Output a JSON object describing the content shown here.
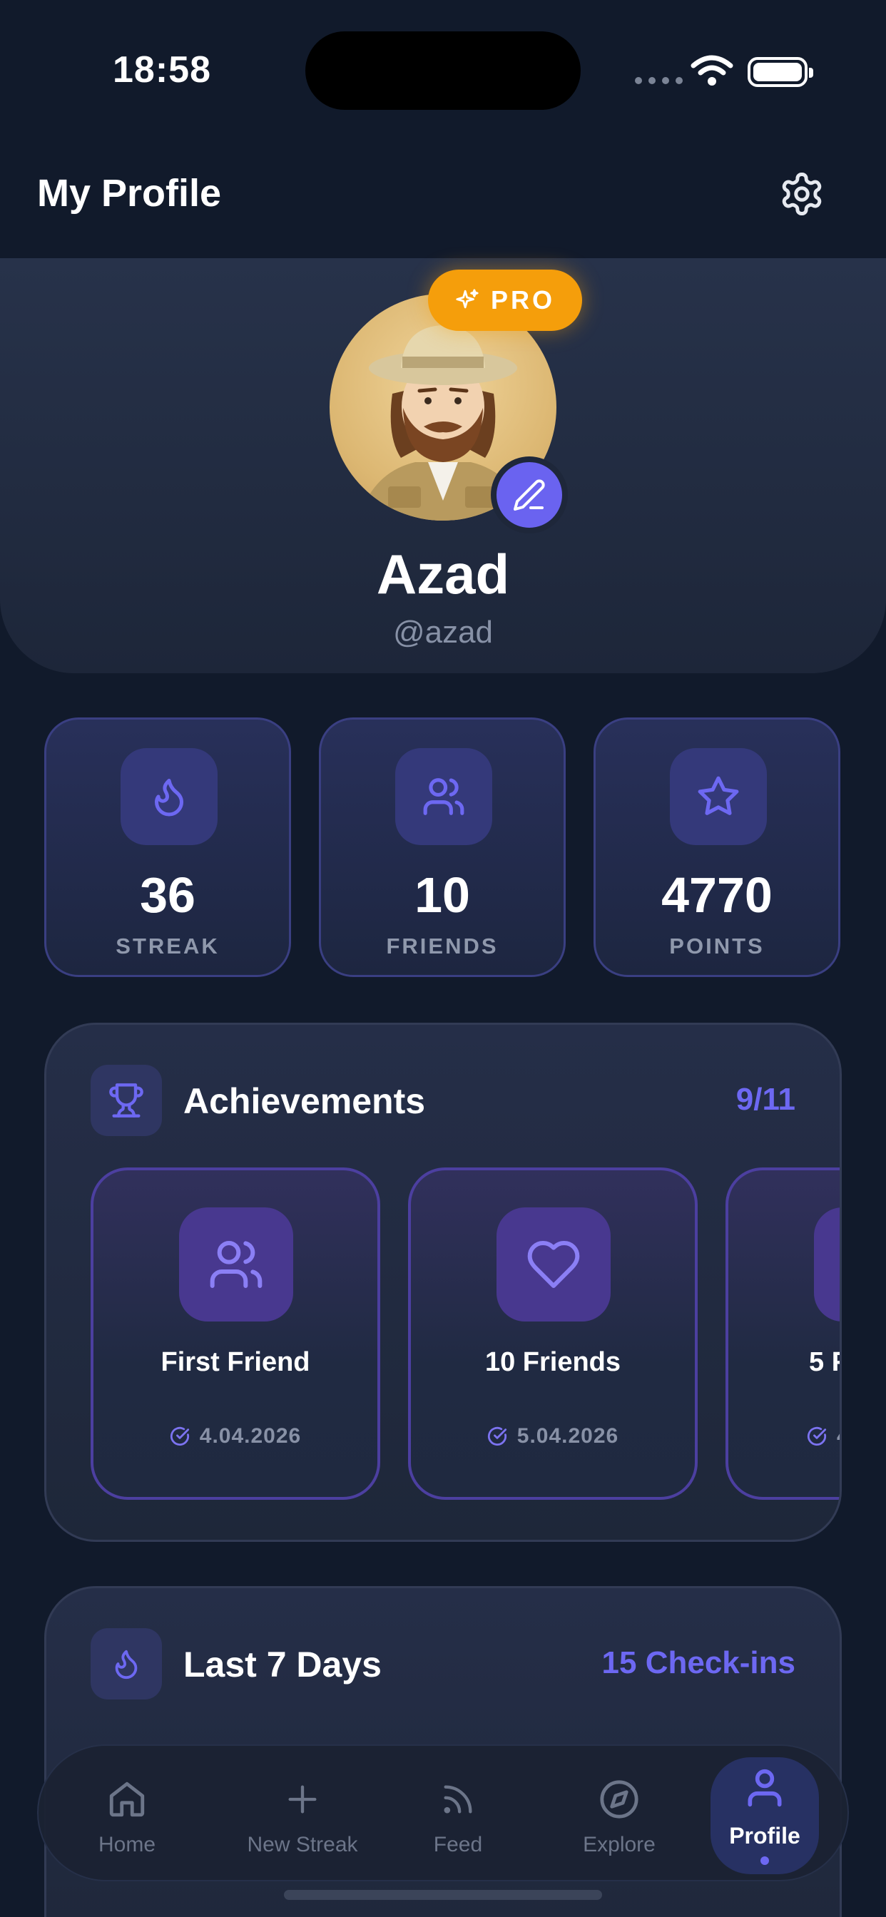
{
  "status_bar": {
    "time": "18:58"
  },
  "header": {
    "title": "My Profile",
    "settings_icon": "gear-icon"
  },
  "profile": {
    "badge": "PRO",
    "name": "Azad",
    "handle": "@azad",
    "accent_color": "#6a63f0",
    "badge_color": "#f59e0b"
  },
  "stats": [
    {
      "icon": "flame-icon",
      "value": "36",
      "label": "STREAK"
    },
    {
      "icon": "friends-icon",
      "value": "10",
      "label": "FRIENDS"
    },
    {
      "icon": "star-icon",
      "value": "4770",
      "label": "POINTS"
    }
  ],
  "achievements": {
    "title": "Achievements",
    "count": "9/11",
    "items": [
      {
        "icon": "friends-icon",
        "title": "First Friend",
        "date": "4.04.2026"
      },
      {
        "icon": "heart-icon",
        "title": "10 Friends",
        "date": "5.04.2026"
      },
      {
        "icon": "friends-icon",
        "title": "5 F",
        "date": "4"
      }
    ]
  },
  "last_7_days": {
    "title": "Last 7 Days",
    "count": "15 Check-ins"
  },
  "tabbar": {
    "tabs": [
      {
        "icon": "home-icon",
        "label": "Home"
      },
      {
        "icon": "plus-icon",
        "label": "New Streak"
      },
      {
        "icon": "rss-icon",
        "label": "Feed"
      },
      {
        "icon": "compass-icon",
        "label": "Explore"
      },
      {
        "icon": "user-icon",
        "label": "Profile"
      }
    ],
    "active": "Profile"
  }
}
